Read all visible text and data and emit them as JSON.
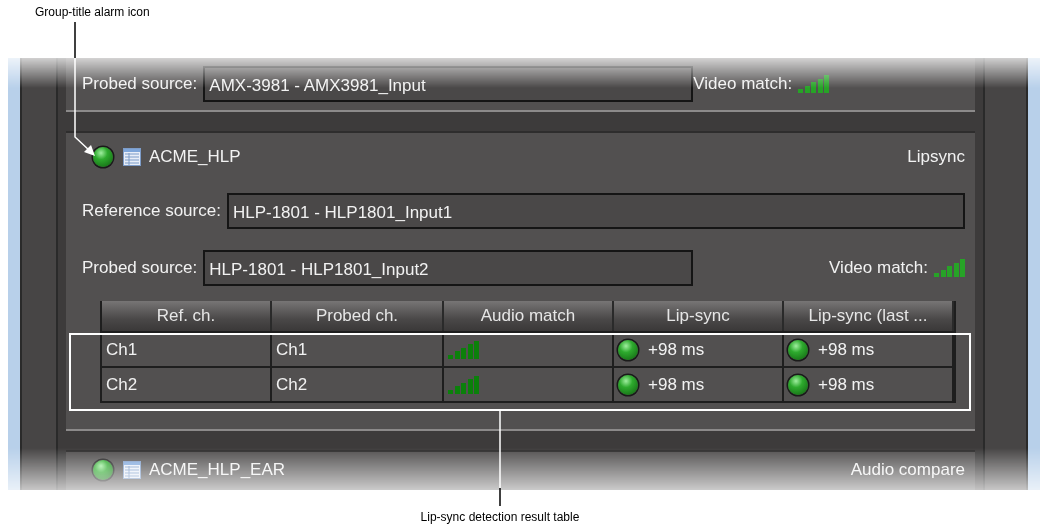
{
  "annotations": {
    "top": "Group-title alarm icon",
    "bottom": "Lip-sync detection result table"
  },
  "previous_group": {
    "probed_label": "Probed source:",
    "probed_value": "AMX-3981 - AMX3981_Input",
    "video_match_label": "Video match:"
  },
  "group": {
    "alarm": false,
    "title": "ACME_HLP",
    "type": "Lipsync",
    "reference_label": "Reference source:",
    "reference_value": "HLP-1801 - HLP1801_Input1",
    "probed_label": "Probed source:",
    "probed_value": "HLP-1801 - HLP1801_Input2",
    "video_match_label": "Video match:",
    "table": {
      "columns": [
        "Ref. ch.",
        "Probed ch.",
        "Audio match",
        "Lip-sync",
        "Lip-sync (last ..."
      ],
      "rows": [
        {
          "ref": "Ch1",
          "probed": "Ch1",
          "lipsync": {
            "alarm": false,
            "text": "+98 ms"
          },
          "lipsync_last": {
            "alarm": false,
            "text": "+98 ms"
          }
        },
        {
          "ref": "Ch2",
          "probed": "Ch2",
          "lipsync": {
            "alarm": false,
            "text": "+98 ms"
          },
          "lipsync_last": {
            "alarm": false,
            "text": "+98 ms"
          }
        }
      ]
    }
  },
  "next_group": {
    "alarm": false,
    "title": "ACME_HLP_EAR",
    "type": "Audio compare"
  }
}
